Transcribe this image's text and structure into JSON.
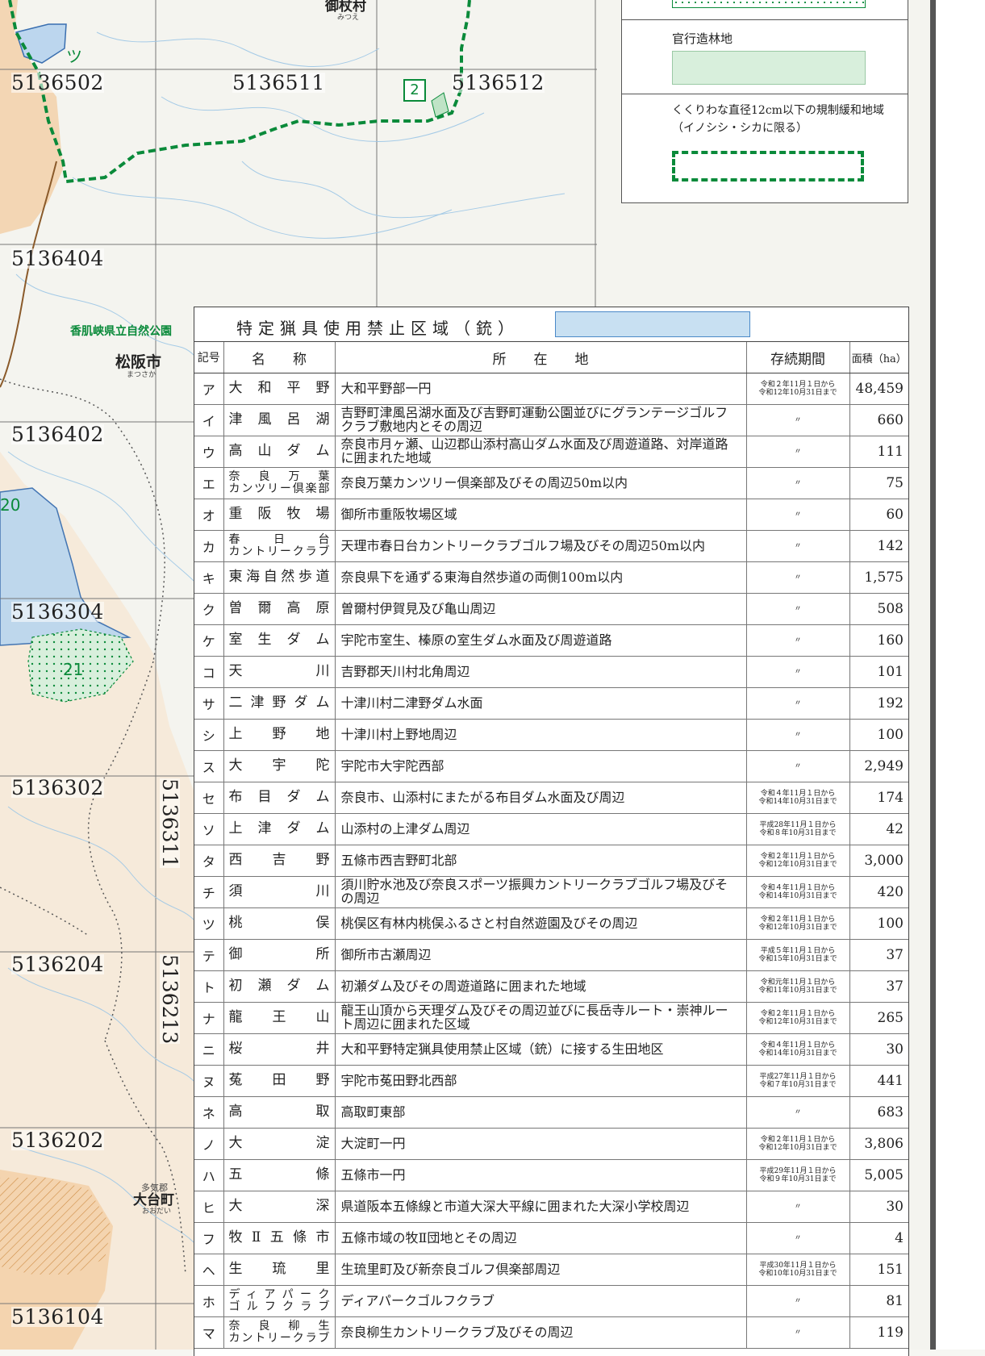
{
  "map": {
    "mesh_codes": [
      "5136502",
      "5136511",
      "5136512",
      "5136404",
      "5136402",
      "5136304",
      "5136302",
      "5136204",
      "5136202",
      "5136104"
    ],
    "mesh_codes_vertical": [
      "5136311",
      "5136213"
    ],
    "places": {
      "mitsue": "御杖村",
      "mitsue_kana": "みつえ",
      "matsusaka": "松阪市",
      "matsusaka_kana": "まつさか",
      "odai": "大台町",
      "odai_gun": "多気郡",
      "odai_kana": "おおだい",
      "park": "香肌峡県立自然公園"
    },
    "zone_labels": {
      "tsu": "ツ",
      "z21": "21",
      "z20": "20",
      "box2": "2"
    },
    "colors": {
      "land": "#f2f2ec",
      "prefecture_orange": "#f3d3ad",
      "lake_blue": "#bcd6ee",
      "green": "#0a8a3a"
    }
  },
  "legend": {
    "item1_pattern": "dotted-green",
    "item2_label": "官行造林地",
    "item3_note_line1": "くくりわな直径12cm以下の規制緩和地域",
    "item3_note_line2": "（イノシシ・シカに限る）"
  },
  "table": {
    "title": "特定猟具使用禁止区域（銃）",
    "swatch_color": "#c8e0f2",
    "headers": {
      "mark": "記号",
      "name": "名　　称",
      "location": "所　　在　　地",
      "period": "存続期間",
      "area": "面積（ha）"
    },
    "rows": [
      {
        "mark": "ア",
        "name": "大和平野",
        "location": "大和平野部一円",
        "period": "令和２年11月１日から\n令和12年10月31日まで",
        "area": "48,459"
      },
      {
        "mark": "イ",
        "name": "津風呂湖",
        "location": "吉野町津風呂湖水面及び吉野町運動公園並びにグランテージゴルフクラブ敷地内とその周辺",
        "period": "〃",
        "area": "660"
      },
      {
        "mark": "ウ",
        "name": "高山ダム",
        "location": "奈良市月ヶ瀬、山辺郡山添村高山ダム水面及び周遊道路、対岸道路に囲まれた地域",
        "period": "〃",
        "area": "111"
      },
      {
        "mark": "エ",
        "name": "奈良万葉\nカンツリー倶楽部",
        "location": "奈良万葉カンツリー倶楽部及びその周辺50m以内",
        "period": "〃",
        "area": "75"
      },
      {
        "mark": "オ",
        "name": "重阪牧場",
        "location": "御所市重阪牧場区域",
        "period": "〃",
        "area": "60"
      },
      {
        "mark": "カ",
        "name": "春日台\nカントリークラブ",
        "location": "天理市春日台カントリークラブゴルフ場及びその周辺50m以内",
        "period": "〃",
        "area": "142"
      },
      {
        "mark": "キ",
        "name": "東海自然歩道",
        "location": "奈良県下を通ずる東海自然歩道の両側100m以内",
        "period": "〃",
        "area": "1,575"
      },
      {
        "mark": "ク",
        "name": "曽爾高原",
        "location": "曽爾村伊賀見及び亀山周辺",
        "period": "〃",
        "area": "508"
      },
      {
        "mark": "ケ",
        "name": "室生ダム",
        "location": "宇陀市室生、榛原の室生ダム水面及び周遊道路",
        "period": "〃",
        "area": "160"
      },
      {
        "mark": "コ",
        "name": "天川",
        "location": "吉野郡天川村北角周辺",
        "period": "〃",
        "area": "101"
      },
      {
        "mark": "サ",
        "name": "二津野ダム",
        "location": "十津川村二津野ダム水面",
        "period": "〃",
        "area": "192"
      },
      {
        "mark": "シ",
        "name": "上野地",
        "location": "十津川村上野地周辺",
        "period": "〃",
        "area": "100"
      },
      {
        "mark": "ス",
        "name": "大宇陀",
        "location": "宇陀市大宇陀西部",
        "period": "〃",
        "area": "2,949"
      },
      {
        "mark": "セ",
        "name": "布目ダム",
        "location": "奈良市、山添村にまたがる布目ダム水面及び周辺",
        "period": "令和４年11月１日から\n令和14年10月31日まで",
        "area": "174"
      },
      {
        "mark": "ソ",
        "name": "上津ダム",
        "location": "山添村の上津ダム周辺",
        "period": "平成28年11月１日から\n令和８年10月31日まで",
        "area": "42"
      },
      {
        "mark": "タ",
        "name": "西吉野",
        "location": "五條市西吉野町北部",
        "period": "令和２年11月１日から\n令和12年10月31日まで",
        "area": "3,000"
      },
      {
        "mark": "チ",
        "name": "須川",
        "location": "須川貯水池及び奈良スポーツ振興カントリークラブゴルフ場及びその周辺",
        "period": "令和４年11月１日から\n令和14年10月31日まで",
        "area": "420"
      },
      {
        "mark": "ツ",
        "name": "桃俣",
        "location": "桃俣区有林内桃俣ふるさと村自然遊園及びその周辺",
        "period": "令和２年11月１日から\n令和12年10月31日まで",
        "area": "100"
      },
      {
        "mark": "テ",
        "name": "御所",
        "location": "御所市古瀬周辺",
        "period": "平成５年11月１日から\n令和15年10月31日まで",
        "area": "37"
      },
      {
        "mark": "ト",
        "name": "初瀬ダム",
        "location": "初瀬ダム及びその周遊道路に囲まれた地域",
        "period": "令和元年11月１日から\n令和11年10月31日まで",
        "area": "37"
      },
      {
        "mark": "ナ",
        "name": "龍王山",
        "location": "龍王山頂から天理ダム及びその周辺並びに長岳寺ルート・崇神ルート周辺に囲まれた区域",
        "period": "令和２年11月１日から\n令和12年10月31日まで",
        "area": "265"
      },
      {
        "mark": "ニ",
        "name": "桜井",
        "location": "大和平野特定猟具使用禁止区域（銃）に接する生田地区",
        "period": "令和４年11月１日から\n令和14年10月31日まで",
        "area": "30"
      },
      {
        "mark": "ヌ",
        "name": "菟田野",
        "location": "宇陀市菟田野北西部",
        "period": "平成27年11月１日から\n令和７年10月31日まで",
        "area": "441"
      },
      {
        "mark": "ネ",
        "name": "高取",
        "location": "高取町東部",
        "period": "〃",
        "area": "683"
      },
      {
        "mark": "ノ",
        "name": "大淀",
        "location": "大淀町一円",
        "period": "令和２年11月１日から\n令和12年10月31日まで",
        "area": "3,806"
      },
      {
        "mark": "ハ",
        "name": "五條",
        "location": "五條市一円",
        "period": "平成29年11月１日から\n令和９年10月31日まで",
        "area": "5,005"
      },
      {
        "mark": "ヒ",
        "name": "大深",
        "location": "県道阪本五條線と市道大深大平線に囲まれた大深小学校周辺",
        "period": "〃",
        "area": "30"
      },
      {
        "mark": "フ",
        "name": "牧Ⅱ五條市",
        "location": "五條市域の牧Ⅱ団地とその周辺",
        "period": "〃",
        "area": "4"
      },
      {
        "mark": "ヘ",
        "name": "生琉里",
        "location": "生琉里町及び新奈良ゴルフ倶楽部周辺",
        "period": "平成30年11月１日から\n令和10年10月31日まで",
        "area": "151"
      },
      {
        "mark": "ホ",
        "name": "ディアパーク\nゴルフクラブ",
        "location": "ディアパークゴルフクラブ",
        "period": "〃",
        "area": "81"
      },
      {
        "mark": "マ",
        "name": "奈良柳生\nカントリークラブ",
        "location": "奈良柳生カントリークラブ及びその周辺",
        "period": "〃",
        "area": "119"
      }
    ]
  }
}
